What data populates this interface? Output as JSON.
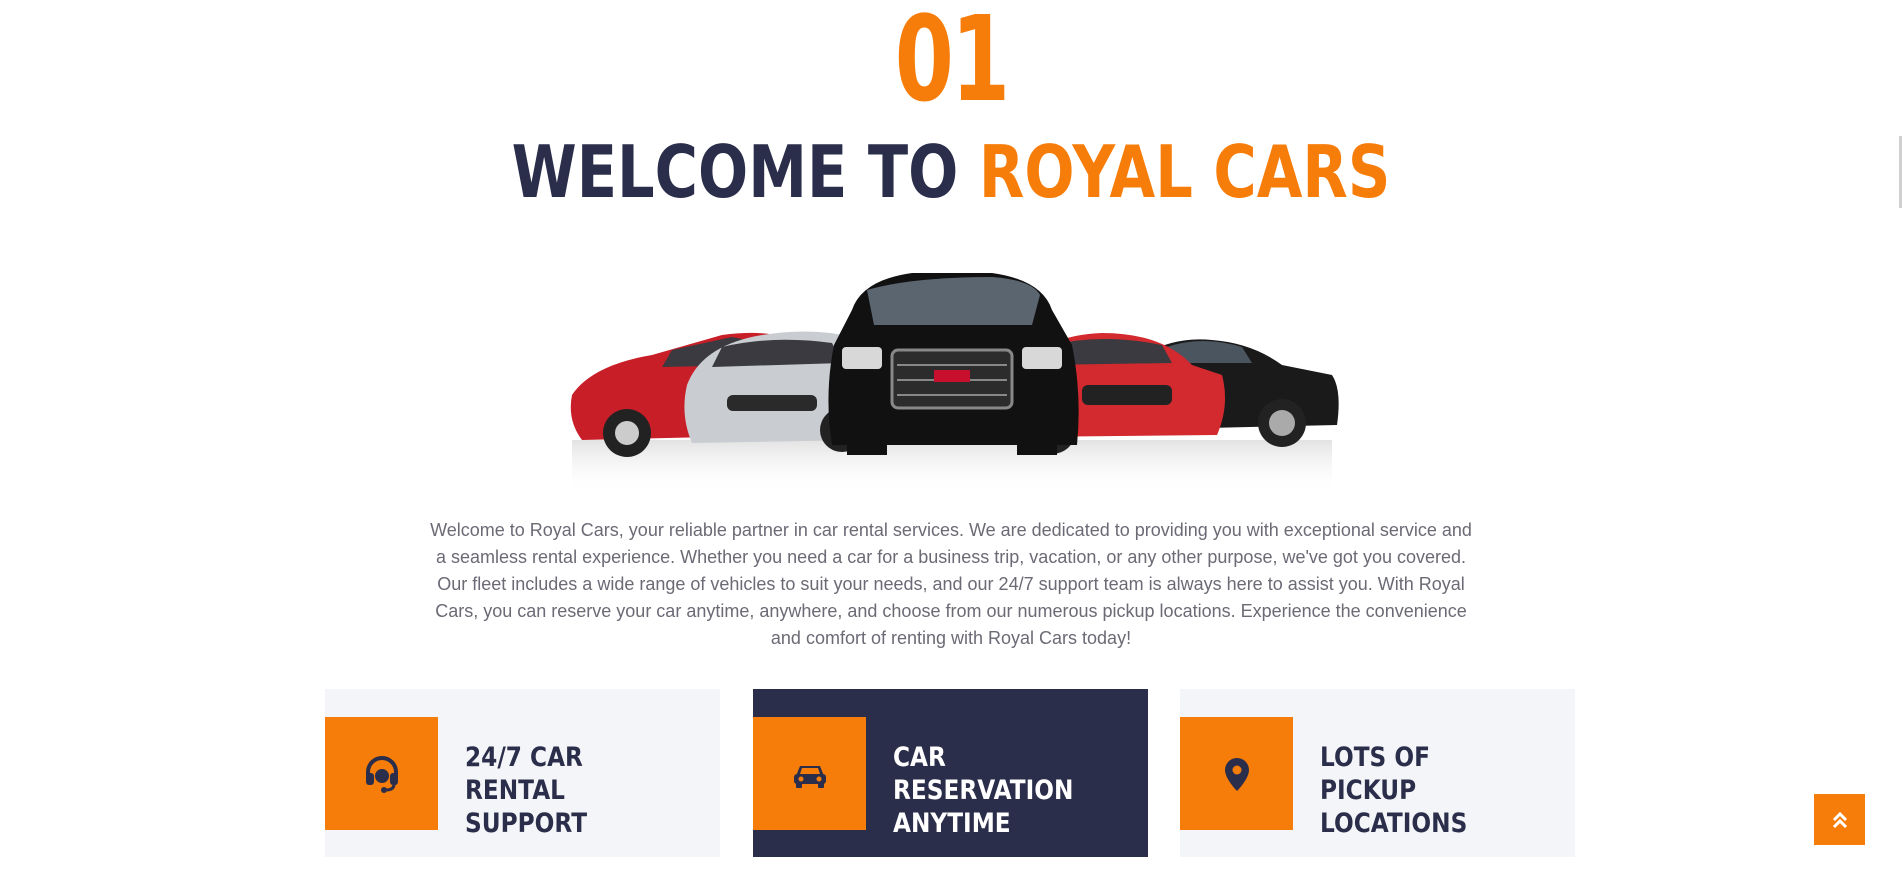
{
  "about": {
    "number": "01",
    "title_part1": "WELCOME TO",
    "title_part2": "ROYAL CARS",
    "image_alt": "Lineup of rental cars",
    "description": "Welcome to Royal Cars, your reliable partner in car rental services. We are dedicated to providing you with exceptional service and a seamless rental experience. Whether you need a car for a business trip, vacation, or any other purpose, we've got you covered. Our fleet includes a wide range of vehicles to suit your needs, and our 24/7 support team is always here to assist you. With Royal Cars, you can reserve your car anytime, anywhere, and choose from our numerous pickup locations. Experience the convenience and comfort of renting with Royal Cars today!"
  },
  "features": [
    {
      "label": "24/7 Car Rental Support",
      "icon": "headset-icon"
    },
    {
      "label": "Car Reservation Anytime",
      "icon": "car-icon"
    },
    {
      "label": "Lots Of Pickup Locations",
      "icon": "map-marker-icon"
    }
  ],
  "back_to_top": {
    "icon": "double-chevron-up-icon"
  },
  "colors": {
    "primary": "#F77D0A",
    "secondary": "#2B2E4A",
    "light": "#F4F5F8",
    "text": "#6B6A75"
  }
}
